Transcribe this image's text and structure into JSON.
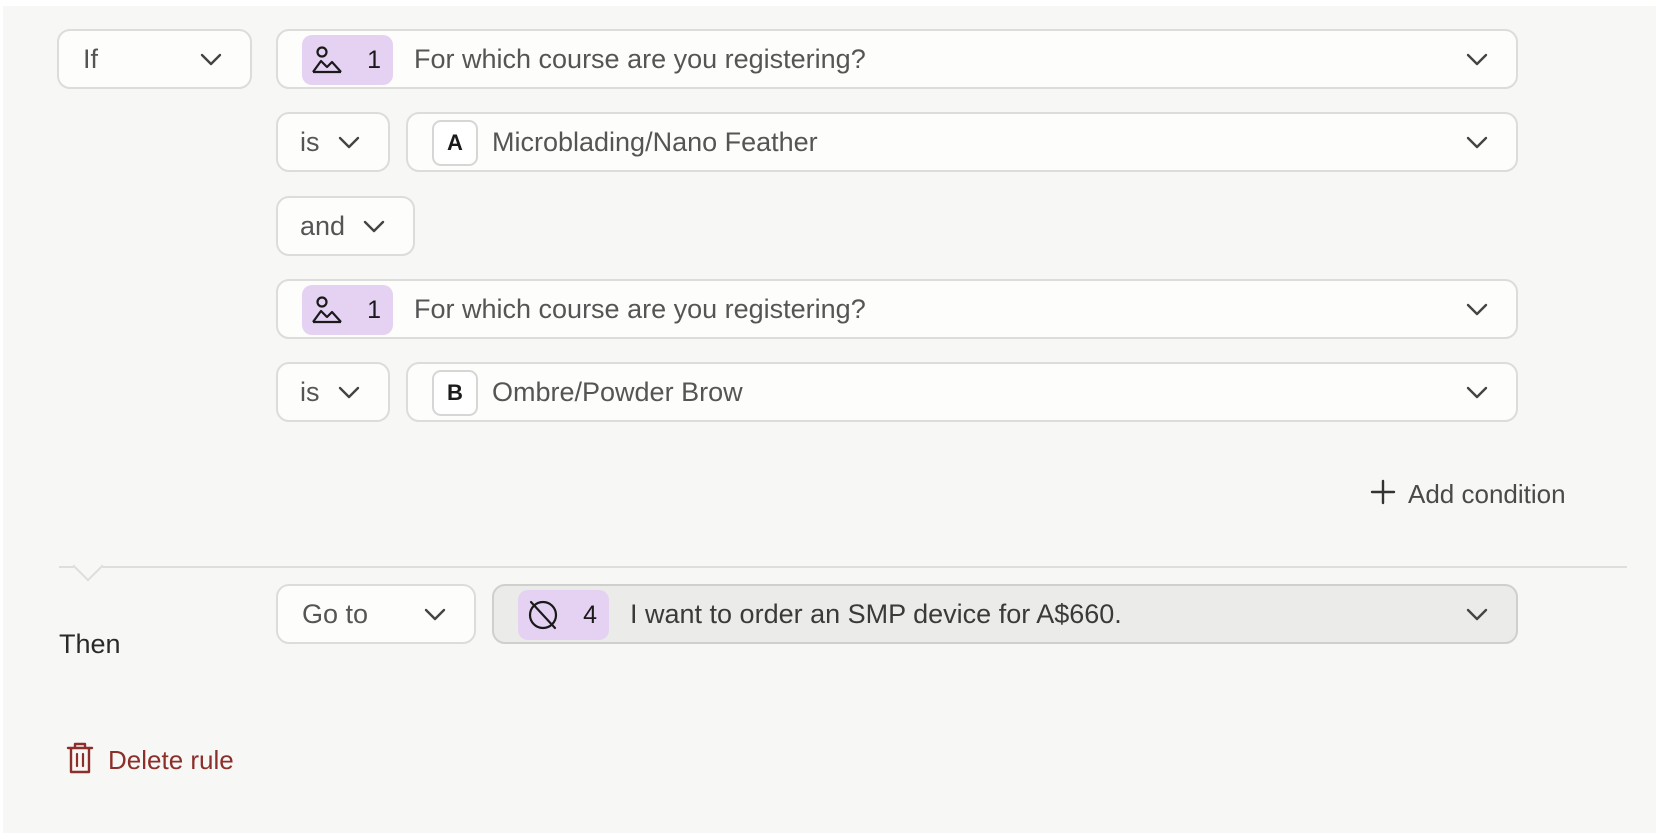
{
  "rule": {
    "if_operator": "If",
    "conditions": [
      {
        "question_number": "1",
        "question_icon": "user-landscape-icon",
        "question_text": "For which course are you registering?",
        "comparator": "is",
        "answer_letter": "A",
        "answer_text": "Microblading/Nano Feather"
      },
      {
        "question_number": "1",
        "question_icon": "user-landscape-icon",
        "question_text": "For which course are you registering?",
        "comparator": "is",
        "answer_letter": "B",
        "answer_text": "Ombre/Powder Brow"
      }
    ],
    "joiner": "and",
    "add_condition_label": "Add condition",
    "then_label": "Then",
    "action": "Go to",
    "target": {
      "number": "4",
      "icon": "disabled-circle-icon",
      "text": "I want to order an SMP device for A$660."
    },
    "delete_label": "Delete rule"
  },
  "colors": {
    "badge_bg": "#e5d2f3",
    "delete_text": "#8c2f2a",
    "panel_bg": "#f7f7f5"
  }
}
